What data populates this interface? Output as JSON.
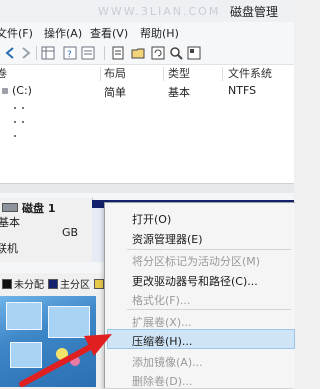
{
  "window": {
    "title": "磁盘管理",
    "watermark": "WWW.3LIAN.COM"
  },
  "menubar": {
    "items": [
      "文件(F)",
      "操作(A)",
      "查看(V)",
      "帮助(H)"
    ]
  },
  "toolbar": {
    "icons": [
      "back-icon",
      "forward-icon",
      "grid-icon",
      "help-icon",
      "properties-icon",
      "folder-icon",
      "refresh-icon",
      "search-icon",
      "list-icon"
    ]
  },
  "volume_list": {
    "columns": [
      "卷",
      "布局",
      "类型",
      "文件系统"
    ],
    "rows": [
      {
        "volume": "(C:)",
        "layout": "简单",
        "type": "基本",
        "fs": "NTFS"
      }
    ]
  },
  "disk": {
    "name": "磁盘 1",
    "type": "基本",
    "size": "GB",
    "status": "联机"
  },
  "legend": {
    "items": [
      "未分配",
      "主分区"
    ],
    "colors": {
      "unallocated": "#111111",
      "primary": "#14226b",
      "accent": "#e8c84a"
    }
  },
  "context_menu": {
    "items": [
      {
        "label": "打开(O)",
        "enabled": true
      },
      {
        "label": "资源管理器(E)",
        "enabled": true
      },
      {
        "label": "将分区标记为活动分区(M)",
        "enabled": false
      },
      {
        "label": "更改驱动器号和路径(C)...",
        "enabled": true
      },
      {
        "label": "格式化(F)...",
        "enabled": false
      },
      {
        "label": "扩展卷(X)...",
        "enabled": false
      },
      {
        "label": "压缩卷(H)...",
        "enabled": true,
        "highlighted": true
      },
      {
        "label": "添加镜像(A)...",
        "enabled": false
      },
      {
        "label": "删除卷(D)...",
        "enabled": false
      }
    ]
  }
}
